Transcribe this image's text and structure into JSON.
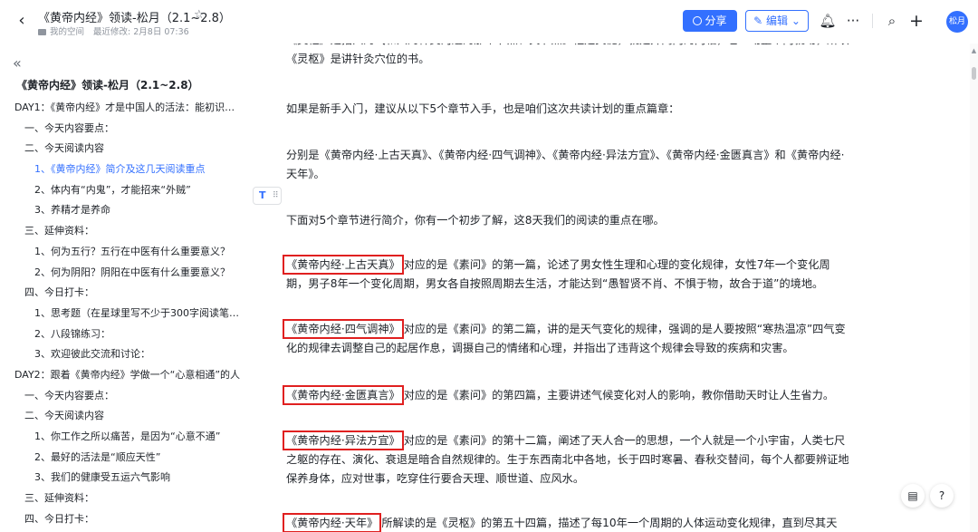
{
  "header": {
    "title": "《黄帝内经》领读-松月（2.1~2.8）",
    "space": "我的空间",
    "last_modified": "最近修改: 2月8日 07:36",
    "share_label": "分享",
    "edit_label": "编辑",
    "avatar_text": "松月"
  },
  "sidebar": {
    "doc_title": "《黄帝内经》领读-松月（2.1~2.8）",
    "items": [
      {
        "label": "DAY1：《黄帝内经》才是中国人的活法：能初识此...",
        "level": 1
      },
      {
        "label": "一、今天内容要点：",
        "level": 2
      },
      {
        "label": "二、今天阅读内容",
        "level": 2
      },
      {
        "label": "1、《黄帝内经》简介及这几天阅读重点",
        "level": 3,
        "active": true
      },
      {
        "label": "2、体内有“内鬼”，才能招来“外贼”",
        "level": 3
      },
      {
        "label": "3、养精才是养命",
        "level": 3
      },
      {
        "label": "三、延伸资料：",
        "level": 2
      },
      {
        "label": "1、何为五行？五行在中医有什么重要意义？",
        "level": 3
      },
      {
        "label": "2、何为阴阳？阴阳在中医有什么重要意义？",
        "level": 3
      },
      {
        "label": "四、今日打卡：",
        "level": 2
      },
      {
        "label": "1、思考题（在星球里写不少于300字阅读笔记...",
        "level": 3
      },
      {
        "label": "2、八段锦练习：",
        "level": 3
      },
      {
        "label": "3、欢迎彼此交流和讨论：",
        "level": 3
      },
      {
        "label": "DAY2：跟着《黄帝内经》学做一个“心意相通”的人",
        "level": 1
      },
      {
        "label": "一、今天内容要点：",
        "level": 2
      },
      {
        "label": "二、今天阅读内容",
        "level": 2
      },
      {
        "label": "1、你工作之所以痛苦，是因为“心意不通”",
        "level": 3
      },
      {
        "label": "2、最好的活法是“顺应天性”",
        "level": 3
      },
      {
        "label": "3、我们的健康受五运六气影响",
        "level": 3
      },
      {
        "label": "三、延伸资料：",
        "level": 2
      },
      {
        "label": "四、今日打卡：",
        "level": 2
      }
    ]
  },
  "content": {
    "top_fragment": "《灵枢》是指人的气和人的神灵沟通的那个节点、关节点。枢是关键，就是开阖门的门轴，它一动整个门就动，所以《灵枢》是讲针灸穴位的书。",
    "p1": "如果是新手入门，建议从以下5个章节入手，也是咱们这次共读计划的重点篇章：",
    "p2": "分别是《黄帝内经·上古天真》、《黄帝内经·四气调神》、《黄帝内经·异法方宜》、《黄帝内经·金匮真言》和《黄帝内经·天年》。",
    "p3": "下面对5个章节进行简介，你有一个初步了解，这8天我们的阅读的重点在哪。",
    "s1_title": "《黄帝内经·上古天真》",
    "s1_text": "对应的是《素问》的第一篇，论述了男女性生理和心理的变化规律，女性7年一个变化周期，男子8年一个变化周期，男女各自按照周期去生活，才能达到“愚智贤不肖、不惧于物，故合于道”的境地。",
    "s2_title": "《黄帝内经·四气调神》",
    "s2_text": "对应的是《素问》的第二篇，讲的是天气变化的规律，强调的是人要按照“寒热温凉”四气变化的规律去调整自己的起居作息，调摄自己的情绪和心理，并指出了违背这个规律会导致的疾病和灾害。",
    "s3_title": "《黄帝内经·金匮真言》",
    "s3_text": "对应的是《素问》的第四篇，主要讲述气候变化对人的影响，教你借助天时让人生省力。",
    "s4_title": "《黄帝内经·异法方宜》",
    "s4_text": "对应的是《素问》的第十二篇，阐述了天人合一的思想，一个人就是一个小宇宙，人类七尺之躯的存在、演化、衰退是暗合自然规律的。生于东西南北中各地，长于四时寒暑、春秋交替间，每个人都要辨证地保养身体，应对世事，吃穿住行要合天理、顺世道、应风水。",
    "s5_title": "《黄帝内经·天年》",
    "s5_text": "所解读的是《灵枢》的第五十四篇，描述了每10年一个周期的人体运动变化规律，直到尽其天"
  },
  "colors": {
    "accent": "#3370ff",
    "highlight_box": "#e02020",
    "text": "#1f2329",
    "muted": "#8f959e"
  },
  "icons": {
    "back": "chevron-left-icon",
    "star": "star-icon",
    "bell": "bell-icon",
    "more": "more-icon",
    "search": "search-icon",
    "plus": "plus-icon"
  }
}
